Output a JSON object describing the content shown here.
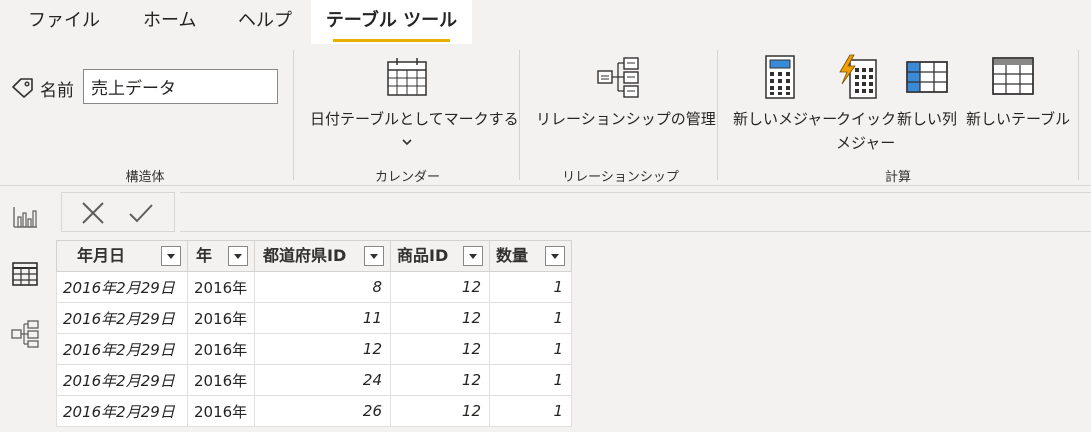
{
  "menu": {
    "tabs": [
      {
        "label": "ファイル"
      },
      {
        "label": "ホーム"
      },
      {
        "label": "ヘルプ"
      },
      {
        "label": "テーブル ツール"
      }
    ]
  },
  "ribbon": {
    "structure": {
      "name_label": "名前",
      "name_value": "売上データ",
      "group_label": "構造体"
    },
    "calendar": {
      "mark_date_label": "日付テーブルとしてマークする",
      "group_label": "カレンダー"
    },
    "relationships": {
      "manage_label": "リレーションシップの管理",
      "group_label": "リレーションシップ"
    },
    "calculations": {
      "new_measure_label": "新しいメジャー",
      "quick_measure_line1": "クイック",
      "quick_measure_line2": "メジャー",
      "new_column_label": "新しい列",
      "new_table_label": "新しいテーブル",
      "group_label": "計算"
    }
  },
  "rail": {
    "icons": [
      "report-view-icon",
      "data-view-icon",
      "model-view-icon"
    ]
  },
  "table": {
    "columns": [
      "年月日",
      "年",
      "都道府県ID",
      "商品ID",
      "数量"
    ],
    "rows": [
      [
        "2016年2月29日",
        "2016年",
        "8",
        "12",
        "1"
      ],
      [
        "2016年2月29日",
        "2016年",
        "11",
        "12",
        "1"
      ],
      [
        "2016年2月29日",
        "2016年",
        "12",
        "12",
        "1"
      ],
      [
        "2016年2月29日",
        "2016年",
        "24",
        "12",
        "1"
      ],
      [
        "2016年2月29日",
        "2016年",
        "26",
        "12",
        "1"
      ]
    ]
  },
  "colors": {
    "accent_underline": "#e8b003",
    "background": "#f3f2f1",
    "measure_icon_blue": "#3a8ad8",
    "lightning_orange": "#f0a000"
  }
}
